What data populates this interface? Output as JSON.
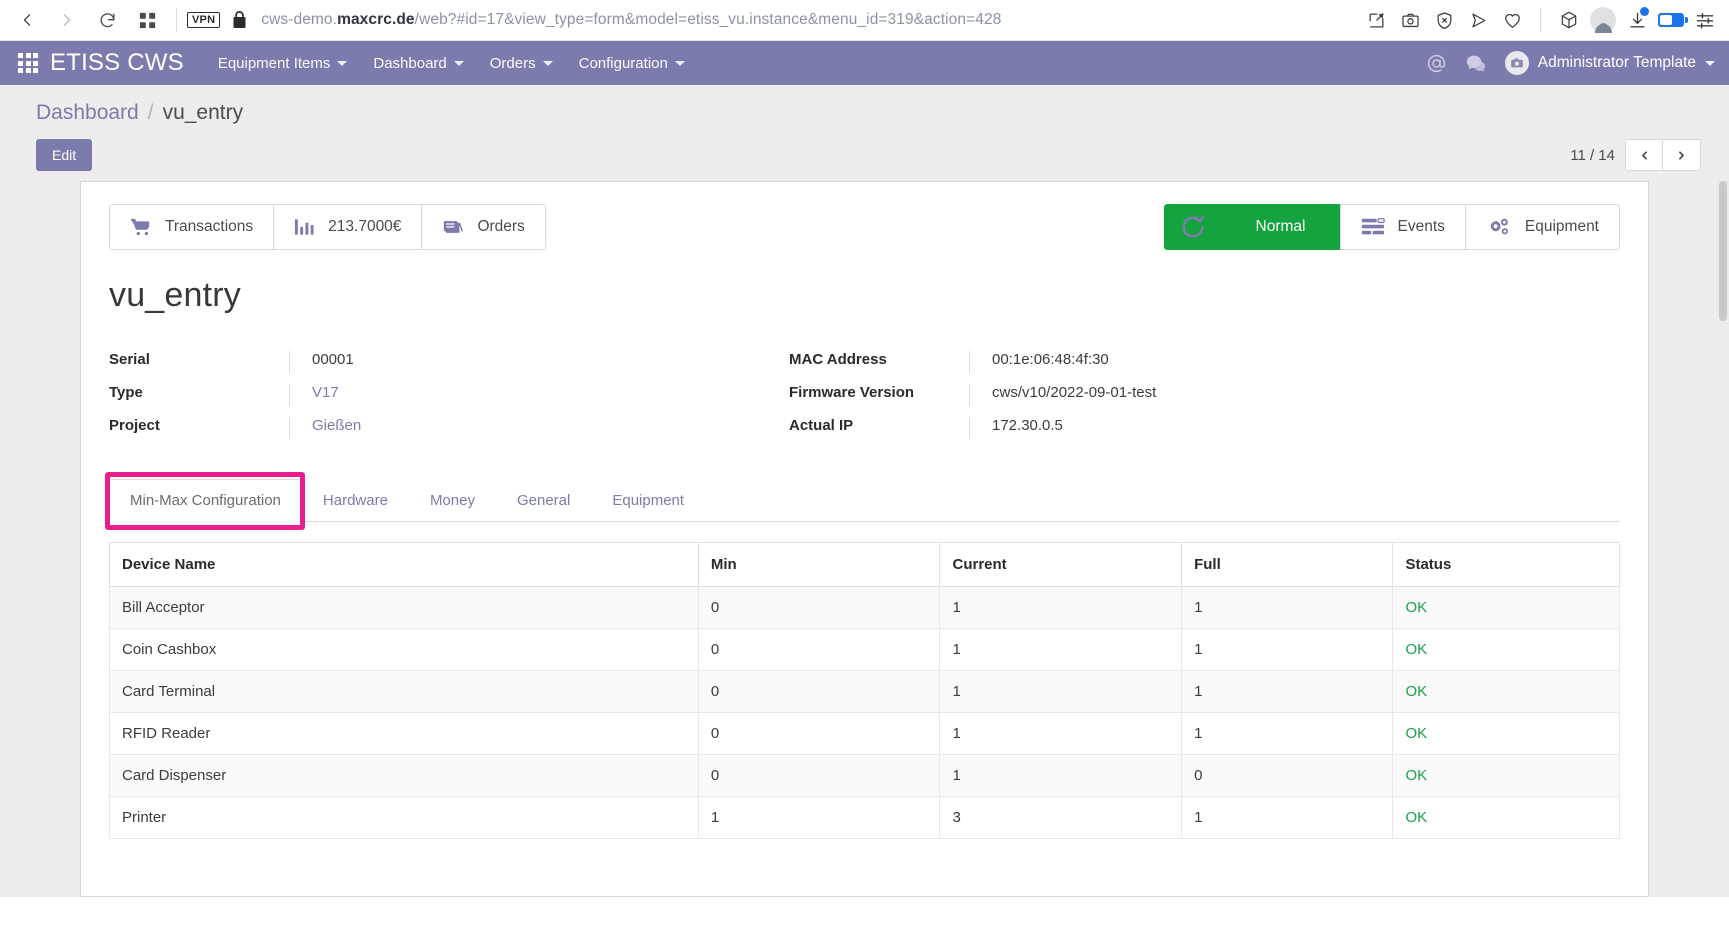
{
  "browser": {
    "back_icon": "chevron-left-icon",
    "forward_icon": "chevron-right-icon",
    "reload_icon": "reload-icon",
    "tabs_icon": "grid-tabs-icon",
    "vpn_label": "VPN",
    "lock_icon": "padlock-icon",
    "url_host": "cws-demo.maxcrc.de",
    "url_host_bold": "maxcrc.de",
    "url_prefix": "cws-demo.",
    "url_path": "/web?#id=17&view_type=form&model=etiss_vu.instance&menu_id=319&action=428",
    "url_full": "cws-demo.maxcrc.de/web?#id=17&view_type=form&model=etiss_vu.instance&menu_id=319&action=428",
    "right_icons": [
      "edit-pin-icon",
      "screenshot-camera-icon",
      "shield-block-icon",
      "send-icon",
      "heart-icon",
      "cube-icon",
      "profile-avatar-icon",
      "downloads-icon",
      "battery-icon",
      "settings-sliders-icon"
    ]
  },
  "app_nav": {
    "apps_icon": "apps-grid-icon",
    "brand": "ETISS CWS",
    "menu": [
      {
        "label": "Equipment Items",
        "has_caret": true
      },
      {
        "label": "Dashboard",
        "has_caret": true
      },
      {
        "label": "Orders",
        "has_caret": true
      },
      {
        "label": "Configuration",
        "has_caret": true
      }
    ],
    "mention_icon": "at-mention-icon",
    "chat_icon": "chat-bubble-icon",
    "user_name": "Administrator Template",
    "user_avatar_icon": "user-avatar-icon",
    "user_caret": true
  },
  "control_panel": {
    "breadcrumb": {
      "root": "Dashboard",
      "separator": "/",
      "current": "vu_entry"
    },
    "edit_label": "Edit",
    "pager": {
      "count": "11 / 14",
      "prev_icon": "chevron-left-icon",
      "next_icon": "chevron-right-icon"
    }
  },
  "sheet": {
    "stat_buttons_left": [
      {
        "label": "Transactions",
        "icon": "shopping-cart-icon"
      },
      {
        "label": "213.7000€",
        "icon": "bar-chart-icon"
      },
      {
        "label": "Orders",
        "icon": "book-orders-icon"
      }
    ],
    "stat_buttons_right": [
      {
        "label": "Normal",
        "icon": "refresh-icon",
        "state": "green"
      },
      {
        "label": "Events",
        "icon": "list-lines-icon"
      },
      {
        "label": "Equipment",
        "icon": "gears-icon"
      }
    ],
    "record_title": "vu_entry",
    "fields_left": [
      {
        "label": "Serial",
        "value": "00001",
        "is_link": false
      },
      {
        "label": "Type",
        "value": "V17",
        "is_link": true
      },
      {
        "label": "Project",
        "value": "Gießen",
        "is_link": true
      }
    ],
    "fields_right": [
      {
        "label": "MAC Address",
        "value": "00:1e:06:48:4f:30",
        "is_link": false
      },
      {
        "label": "Firmware Version",
        "value": "cws/v10/2022-09-01-test",
        "is_link": false
      },
      {
        "label": "Actual IP",
        "value": "172.30.0.5",
        "is_link": false
      }
    ],
    "tabs": [
      {
        "label": "Min-Max Configuration",
        "active": true,
        "highlighted": true
      },
      {
        "label": "Hardware",
        "active": false,
        "highlighted": false
      },
      {
        "label": "Money",
        "active": false,
        "highlighted": false
      },
      {
        "label": "General",
        "active": false,
        "highlighted": false
      },
      {
        "label": "Equipment",
        "active": false,
        "highlighted": false
      }
    ],
    "table": {
      "headers": [
        "Device Name",
        "Min",
        "Current",
        "Full",
        "Status"
      ],
      "rows": [
        {
          "device": "Bill Acceptor",
          "min": "0",
          "current": "1",
          "full": "1",
          "status": "OK"
        },
        {
          "device": "Coin Cashbox",
          "min": "0",
          "current": "1",
          "full": "1",
          "status": "OK"
        },
        {
          "device": "Card Terminal",
          "min": "0",
          "current": "1",
          "full": "1",
          "status": "OK"
        },
        {
          "device": "RFID Reader",
          "min": "0",
          "current": "1",
          "full": "1",
          "status": "OK"
        },
        {
          "device": "Card Dispenser",
          "min": "0",
          "current": "1",
          "full": "0",
          "status": "OK"
        },
        {
          "device": "Printer",
          "min": "1",
          "current": "3",
          "full": "1",
          "status": "OK"
        }
      ]
    }
  },
  "colors": {
    "brand_purple": "#7c7bad",
    "status_green": "#14a33f",
    "ok_green": "#1a9e4b",
    "highlight_pink": "#e91e8c",
    "page_bg": "#eeecec"
  }
}
